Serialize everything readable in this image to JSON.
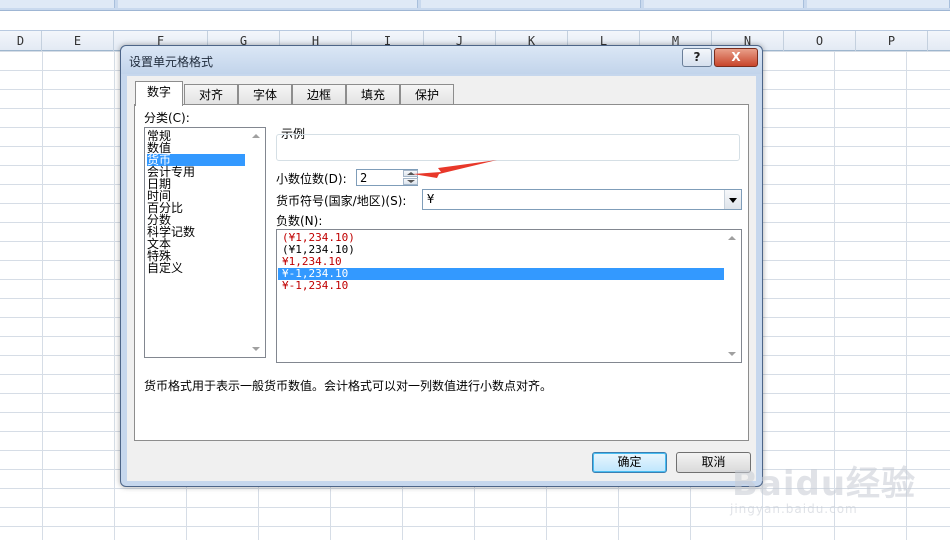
{
  "sheet": {
    "columns": [
      "D",
      "E",
      "F",
      "G",
      "H",
      "I",
      "J",
      "K",
      "L",
      "M",
      "N",
      "O",
      "P"
    ]
  },
  "dialog": {
    "title": "设置单元格格式",
    "help_label": "?",
    "close_label": "X",
    "tabs": [
      "数字",
      "对齐",
      "字体",
      "边框",
      "填充",
      "保护"
    ],
    "active_tab": "数字",
    "category_label": "分类(C):",
    "categories": [
      "常规",
      "数值",
      "货币",
      "会计专用",
      "日期",
      "时间",
      "百分比",
      "分数",
      "科学记数",
      "文本",
      "特殊",
      "自定义"
    ],
    "selected_category": "货币",
    "sample_label": "示例",
    "decimal_label": "小数位数(D):",
    "decimal_value": "2",
    "currency_label": "货币符号(国家/地区)(S):",
    "currency_value": "¥",
    "negative_label": "负数(N):",
    "negative_options": [
      {
        "text": "(¥1,234.10)",
        "color": "#c00000"
      },
      {
        "text": "(¥1,234.10)",
        "color": "#000000"
      },
      {
        "text": "¥1,234.10",
        "color": "#c00000"
      },
      {
        "text": "¥-1,234.10",
        "color": "#ffffff"
      },
      {
        "text": "¥-1,234.10",
        "color": "#c00000"
      }
    ],
    "selected_negative_index": 3,
    "description": "货币格式用于表示一般货币数值。会计格式可以对一列数值进行小数点对齐。",
    "ok_label": "确定",
    "cancel_label": "取消"
  },
  "watermark": {
    "brand": "Baidu经验",
    "url": "jingyan.baidu.com"
  },
  "colors": {
    "selection": "#3399ff",
    "annotation_arrow": "#e8382a",
    "negative_red": "#c00000"
  }
}
